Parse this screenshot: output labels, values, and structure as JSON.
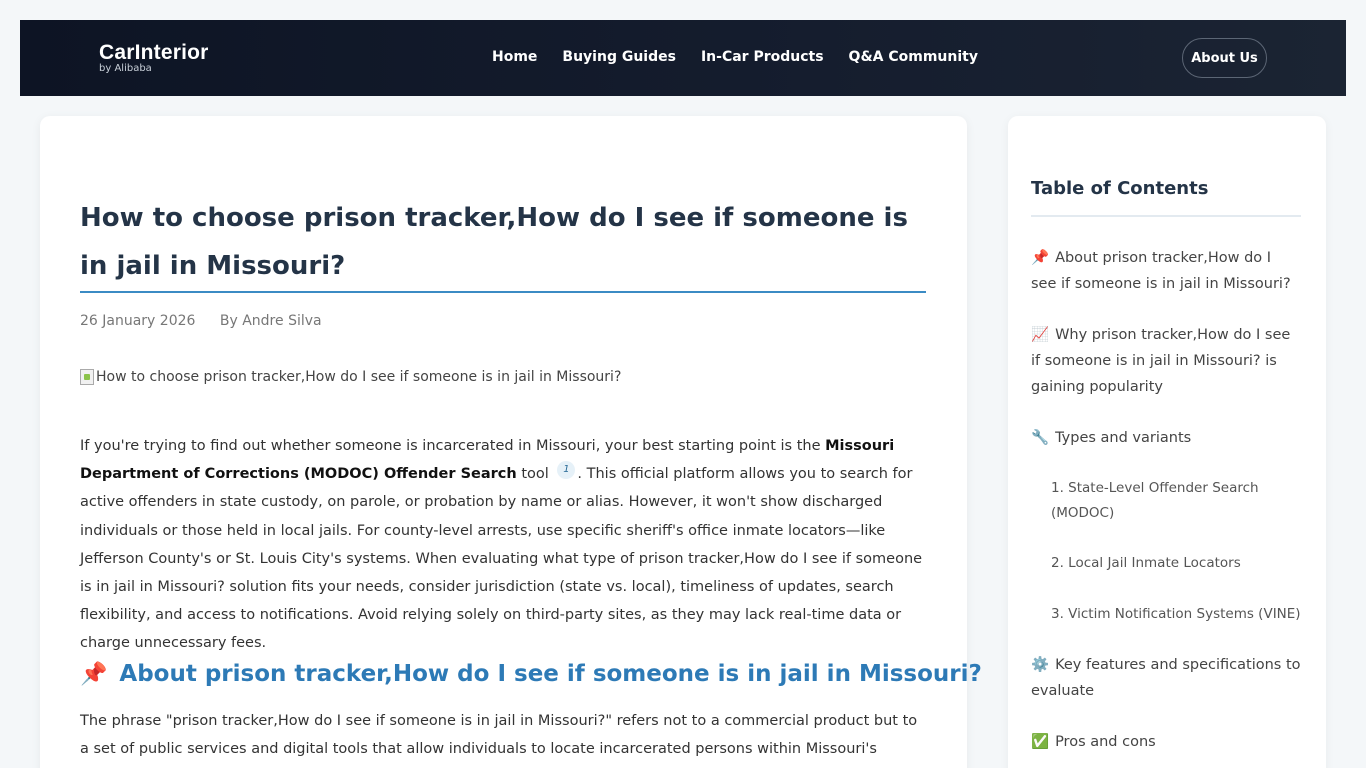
{
  "header": {
    "brand": "CarInterior",
    "brand_sub": "by Alibaba",
    "nav": [
      "Home",
      "Buying Guides",
      "In-Car Products",
      "Q&A Community"
    ],
    "about": "About Us"
  },
  "article": {
    "title": "How to choose prison tracker,How do I see if someone is in jail in Missouri?",
    "date": "26 January 2026",
    "author": "By Andre Silva",
    "image_alt": "How to choose prison tracker,How do I see if someone is in jail in Missouri?",
    "intro_a": "If you're trying to find out whether someone is incarcerated in Missouri, your best starting point is the ",
    "intro_bold": "Missouri Department of Corrections (MODOC) Offender Search",
    "intro_b": " tool ",
    "cite": "1",
    "intro_c": ". This official platform allows you to search for active offenders in state custody, on parole, or probation by name or alias. However, it won't show discharged individuals or those held in local jails. For county-level arrests, use specific sheriff's office inmate locators—like Jefferson County's or St. Louis City's systems. When evaluating what type of prison tracker,How do I see if someone is in jail in Missouri? solution fits your needs, consider jurisdiction (state vs. local), timeliness of updates, search flexibility, and access to notifications. Avoid relying solely on third-party sites, as they may lack real-time data or charge unnecessary fees.",
    "h2_icon": "📌",
    "h2": "About prison tracker,How do I see if someone is in jail in Missouri?",
    "para2": "The phrase \"prison tracker,How do I see if someone is in jail in Missouri?\" refers not to a commercial product but to a set of public services and digital tools that allow individuals to locate incarcerated persons within Missouri's correctional"
  },
  "toc": {
    "title": "Table of Contents",
    "items": [
      {
        "icon": "📌",
        "label": "About prison tracker,How do I see if someone is in jail in Missouri?"
      },
      {
        "icon": "📈",
        "label": "Why prison tracker,How do I see if someone is in jail in Missouri? is gaining popularity"
      },
      {
        "icon": "🔧",
        "label": "Types and variants"
      },
      {
        "label": "1. State-Level Offender Search (MODOC)"
      },
      {
        "label": "2. Local Jail Inmate Locators"
      },
      {
        "label": "3. Victim Notification Systems (VINE)"
      },
      {
        "icon": "⚙️",
        "label": "Key features and specifications to evaluate"
      },
      {
        "icon": "✅",
        "label": "Pros and cons"
      }
    ]
  }
}
